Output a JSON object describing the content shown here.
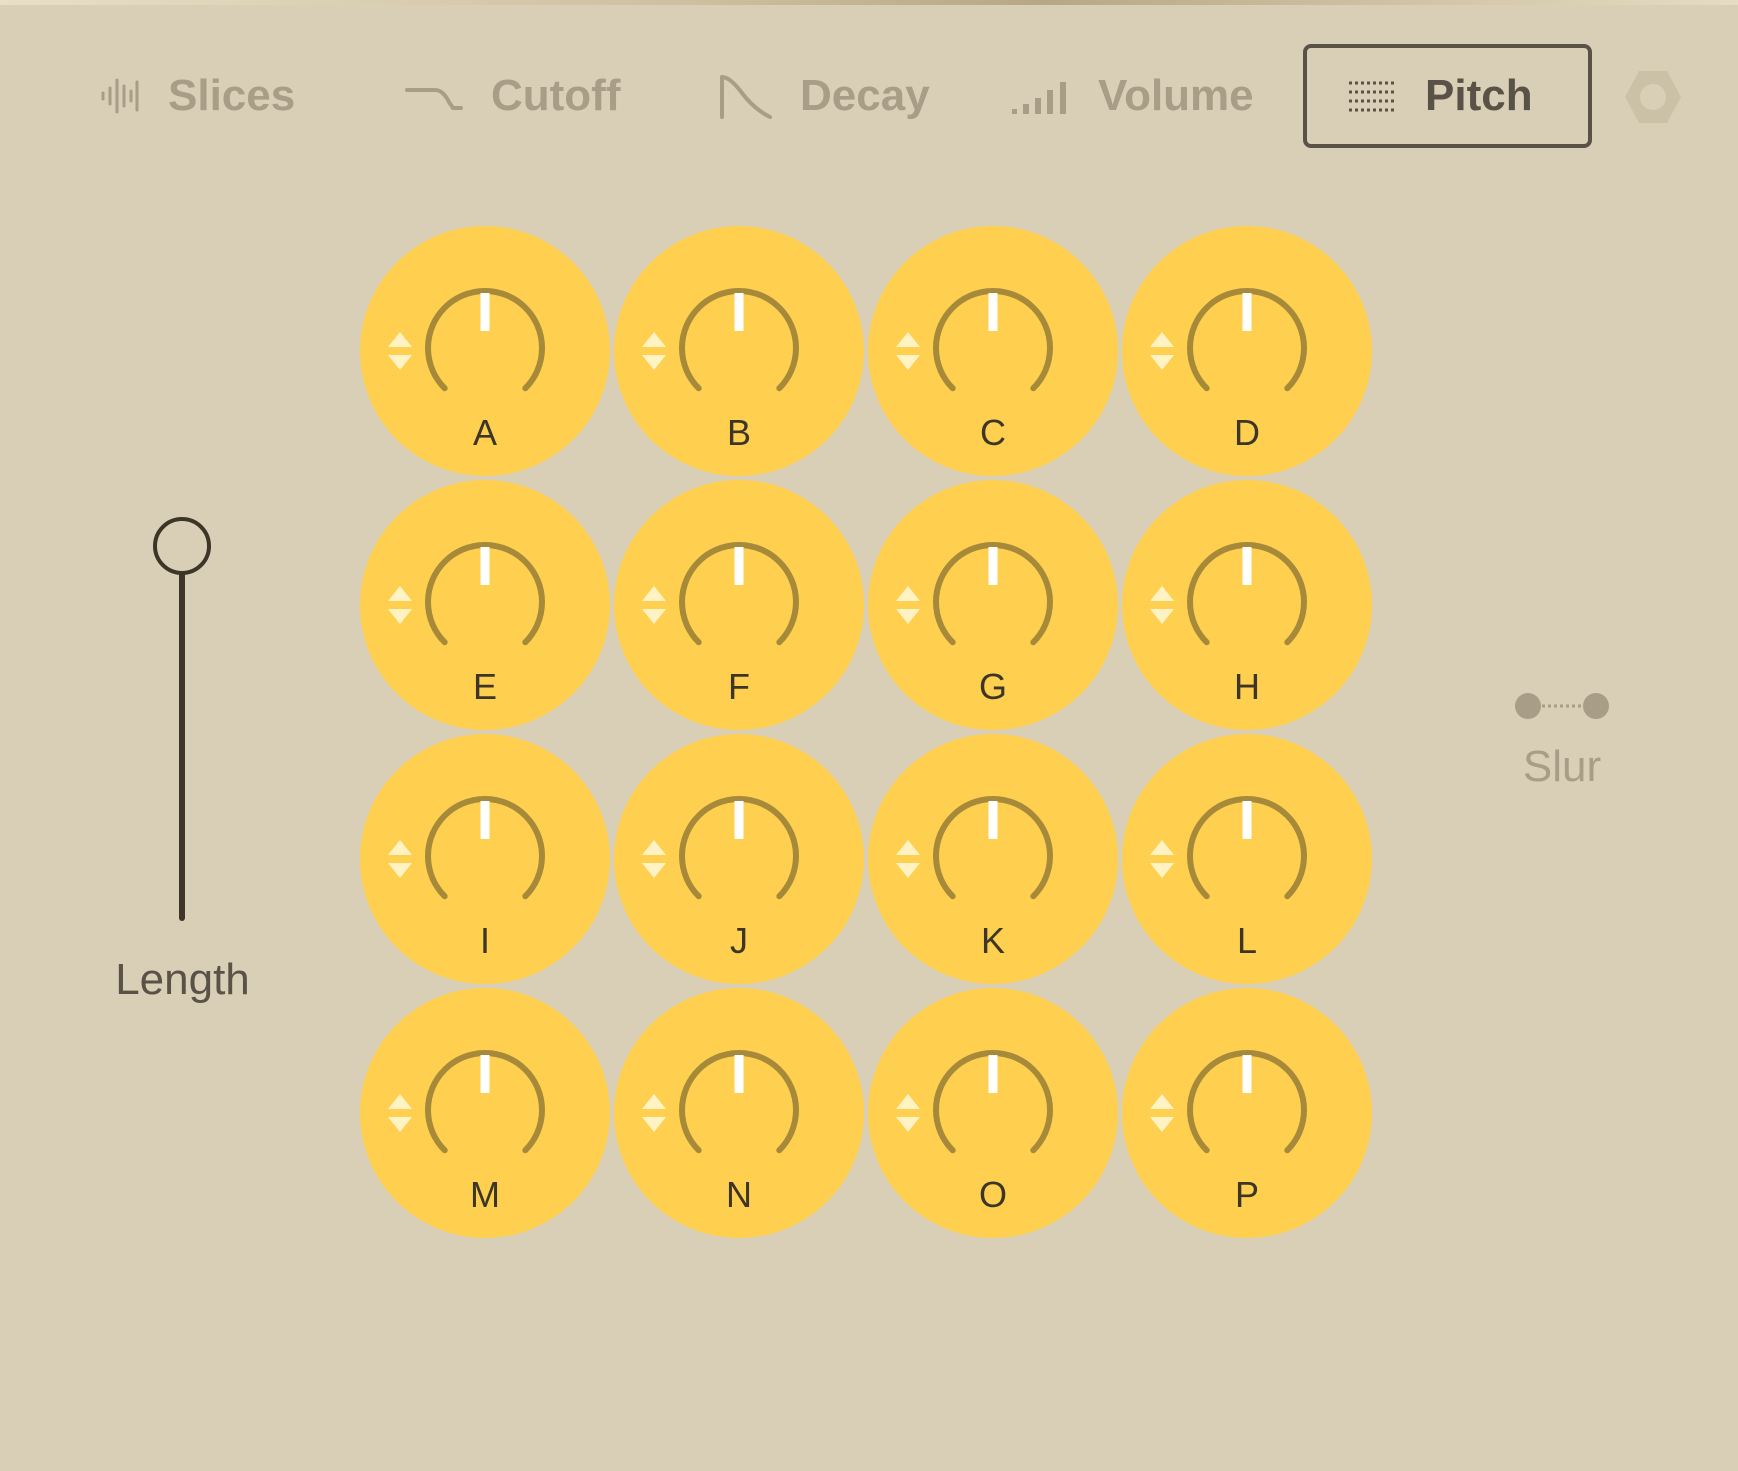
{
  "tabs": {
    "slices": {
      "label": "Slices",
      "icon": "waveform-icon",
      "active": false
    },
    "cutoff": {
      "label": "Cutoff",
      "icon": "cutoff-curve-icon",
      "active": false
    },
    "decay": {
      "label": "Decay",
      "icon": "decay-envelope-icon",
      "active": false
    },
    "volume": {
      "label": "Volume",
      "icon": "volume-bars-icon",
      "active": false
    },
    "pitch": {
      "label": "Pitch",
      "icon": "pitch-lines-icon",
      "active": true
    }
  },
  "settings": {
    "icon": "hexagon-settings-icon"
  },
  "length": {
    "label": "Length",
    "value": 1.0
  },
  "slur": {
    "label": "Slur",
    "icon": "slur-icon"
  },
  "pads": {
    "labels": [
      "A",
      "B",
      "C",
      "D",
      "E",
      "F",
      "G",
      "H",
      "I",
      "J",
      "K",
      "L",
      "M",
      "N",
      "O",
      "P"
    ],
    "knob_value": 0.5
  },
  "colors": {
    "background": "#d8cfb6",
    "pad": "#ffcf4f",
    "knob_arc": "#a68a3a",
    "knob_pointer": "#ffffff",
    "active_text": "#5a5246",
    "inactive_text": "#a89e88"
  }
}
